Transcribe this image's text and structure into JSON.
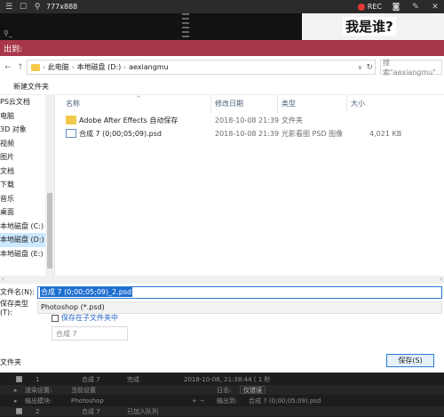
{
  "topbar": {
    "size_label": "777x888",
    "rec_label": "REC"
  },
  "caption": "我是谁?",
  "dialog": {
    "title": "出到:",
    "address": [
      "此电脑",
      "本地磁盘 (D:)",
      "aexiangmu"
    ],
    "search_placeholder": "搜索\"aexiangmu\"",
    "new_folder": "新建文件夹",
    "nav_items": [
      "PS云文档",
      "电脑",
      "3D 对象",
      "视频",
      "图片",
      "文档",
      "下载",
      "音乐",
      "桌面",
      "本地磁盘 (C:)",
      "本地磁盘 (D:)",
      "本地磁盘 (E:)"
    ],
    "selected_nav_index": 10,
    "columns": {
      "name": "名称",
      "date": "修改日期",
      "type": "类型",
      "size": "大小"
    },
    "files": [
      {
        "name": "Adobe After Effects 自动保存",
        "date": "2018-10-08 21:39",
        "type": "文件夹",
        "size": "",
        "icon": "folder-icon"
      },
      {
        "name": "合成 7 (0;00;05;09).psd",
        "date": "2018-10-08 21:39",
        "type": "光影看图 PSD 图像",
        "size": "4,021 KB",
        "icon": "psd-file-icon"
      }
    ],
    "filename_label": "文件名(N):",
    "filename_value": "合成 7 (0;00;05;09)_2.psd",
    "filetype_label": "保存类型(T):",
    "filetype_value": "Photoshop (*.psd)",
    "subfolder_label": "保存在子文件夹中",
    "subfolder_name": "合成 7",
    "hide_folders_label": "文件夹",
    "save_button": "保存(S)"
  },
  "render_queue": {
    "row1": {
      "index": "1",
      "name": "合成 7",
      "status": "完成",
      "time": "2018-10-08, 21:38:44 ( 1 秒"
    },
    "row2": {
      "settings_label": "渲染设置:",
      "settings_value": "当前设置",
      "log_label": "日志:",
      "log_value": "仅错误"
    },
    "row3": {
      "module_label": "输出模块:",
      "module_value": "Photoshop",
      "output_label": "输出到:",
      "output_value": "合成 7 (0;00;05;09).psd"
    },
    "row4": {
      "index": "2",
      "name": "合成 7",
      "status": "已加入队列"
    }
  }
}
